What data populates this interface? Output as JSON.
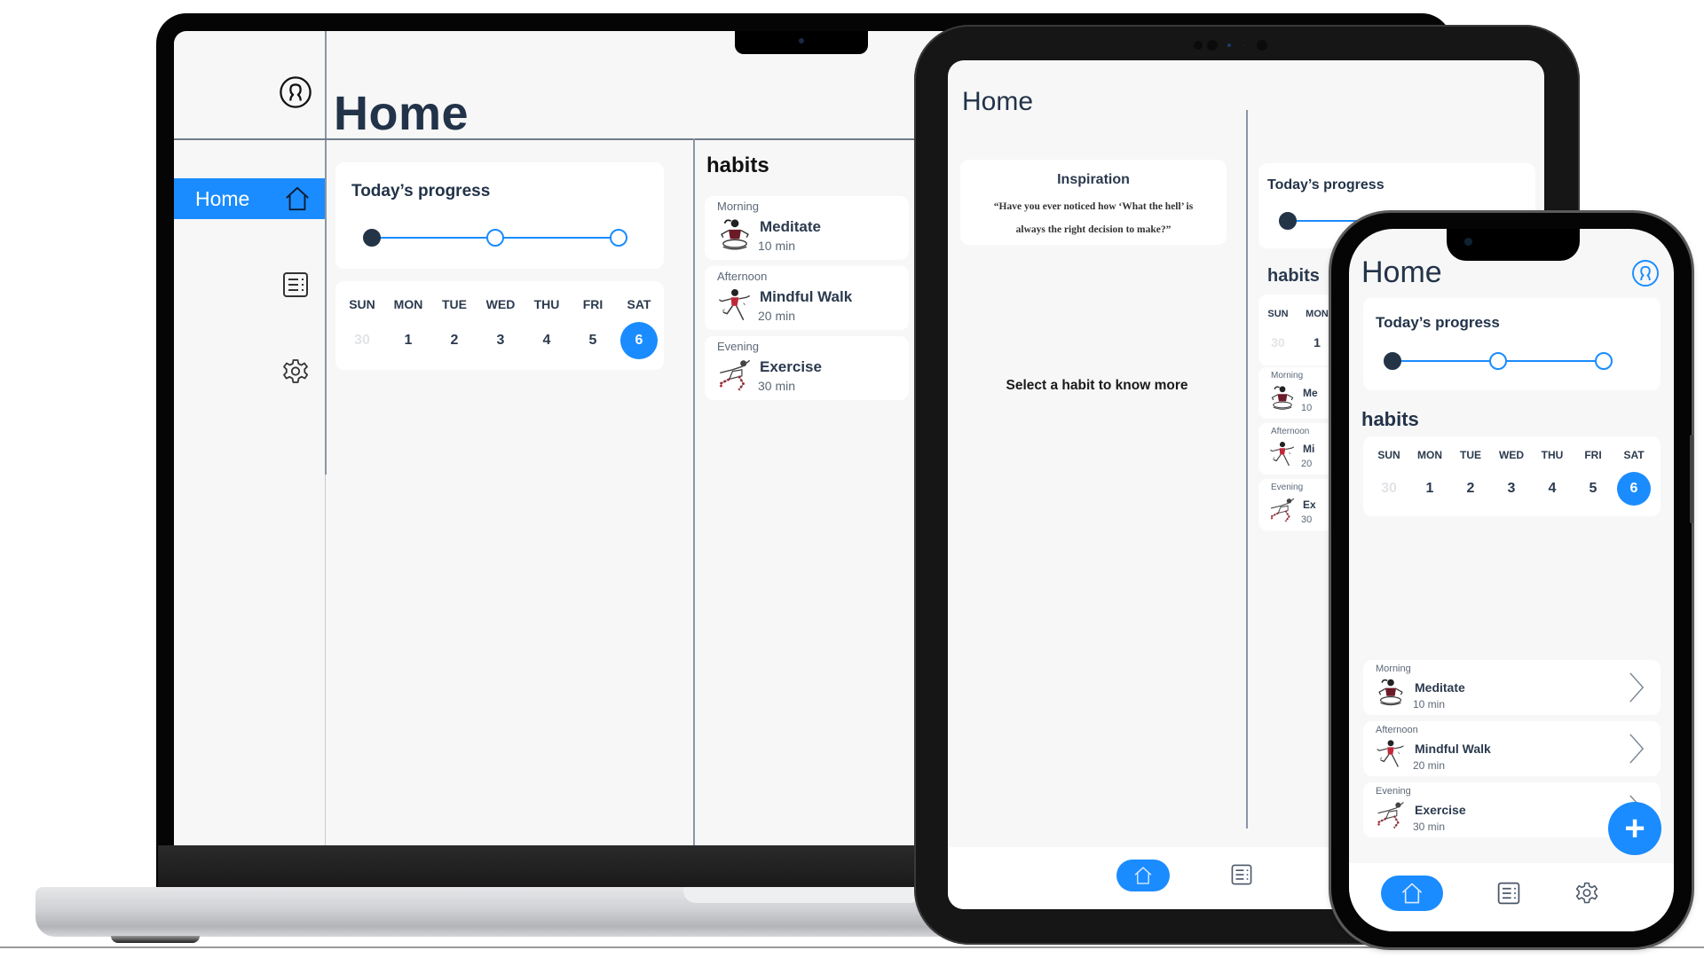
{
  "colors": {
    "accent": "#1a8cff",
    "text_dark": "#223349",
    "progress_done": "#243447",
    "background": "#f7f7f7",
    "card": "#ffffff"
  },
  "laptop": {
    "title": "Home",
    "sidebar": {
      "items": [
        {
          "label": "Home",
          "icon": "home-icon",
          "active": true
        },
        {
          "label": "",
          "icon": "list-icon",
          "active": false
        },
        {
          "label": "",
          "icon": "gear-icon",
          "active": false
        }
      ],
      "profile_icon": "user-icon"
    },
    "progress": {
      "title": "Today’s  progress",
      "steps_total": 3,
      "steps_completed": 1
    },
    "calendar": {
      "weekdays": [
        "SUN",
        "MON",
        "TUE",
        "WED",
        "THU",
        "FRI",
        "SAT"
      ],
      "days": [
        {
          "label": "30",
          "state": "faded"
        },
        {
          "label": "1",
          "state": "normal"
        },
        {
          "label": "2",
          "state": "normal"
        },
        {
          "label": "3",
          "state": "normal"
        },
        {
          "label": "4",
          "state": "normal"
        },
        {
          "label": "5",
          "state": "normal"
        },
        {
          "label": "6",
          "state": "selected"
        }
      ]
    },
    "habits": {
      "title": "habits",
      "items": [
        {
          "period": "Morning",
          "name": "Meditate",
          "duration": "10 min",
          "figure": "meditate-figure-icon"
        },
        {
          "period": "Afternoon",
          "name": "Mindful Walk",
          "duration": "20 min",
          "figure": "walk-figure-icon"
        },
        {
          "period": "Evening",
          "name": "Exercise",
          "duration": "30 min",
          "figure": "exercise-figure-icon"
        }
      ]
    }
  },
  "tablet": {
    "title": "Home",
    "inspiration": {
      "title": "Inspiration",
      "quote": "“Have you ever noticed how ‘What the hell’ is always the right decision to make?”"
    },
    "empty_state": "Select a habit to know more",
    "progress": {
      "title": "Today’s  progress",
      "steps_total": 3,
      "steps_completed": 1
    },
    "habits_title": "habits",
    "calendar": {
      "weekdays": [
        "SUN",
        "MON"
      ],
      "days": [
        {
          "label": "30",
          "state": "faded"
        },
        {
          "label": "1",
          "state": "normal"
        }
      ]
    },
    "habits": [
      {
        "period": "Morning",
        "name": "Me",
        "duration": "10"
      },
      {
        "period": "Afternoon",
        "name": "Mi",
        "duration": "20"
      },
      {
        "period": "Evening",
        "name": "Ex",
        "duration": "30"
      }
    ],
    "bottom_nav": [
      {
        "icon": "home-icon",
        "active": true
      },
      {
        "icon": "list-icon",
        "active": false
      }
    ]
  },
  "phone": {
    "title": "Home",
    "profile_icon": "user-icon",
    "progress": {
      "title": "Today’s  progress",
      "steps_total": 3,
      "steps_completed": 1
    },
    "habits_title": "habits",
    "calendar": {
      "weekdays": [
        "SUN",
        "MON",
        "TUE",
        "WED",
        "THU",
        "FRI",
        "SAT"
      ],
      "days": [
        {
          "label": "30",
          "state": "faded"
        },
        {
          "label": "1",
          "state": "normal"
        },
        {
          "label": "2",
          "state": "normal"
        },
        {
          "label": "3",
          "state": "normal"
        },
        {
          "label": "4",
          "state": "normal"
        },
        {
          "label": "5",
          "state": "normal"
        },
        {
          "label": "6",
          "state": "selected"
        }
      ]
    },
    "habits": [
      {
        "period": "Morning",
        "name": "Meditate",
        "duration": "10 min"
      },
      {
        "period": "Afternoon",
        "name": "Mindful Walk",
        "duration": "20 min"
      },
      {
        "period": "Evening",
        "name": "Exercise",
        "duration": "30 min"
      }
    ],
    "fab_label": "+",
    "bottom_nav": [
      {
        "icon": "home-icon",
        "active": true
      },
      {
        "icon": "list-icon",
        "active": false
      },
      {
        "icon": "gear-icon",
        "active": false
      }
    ]
  }
}
